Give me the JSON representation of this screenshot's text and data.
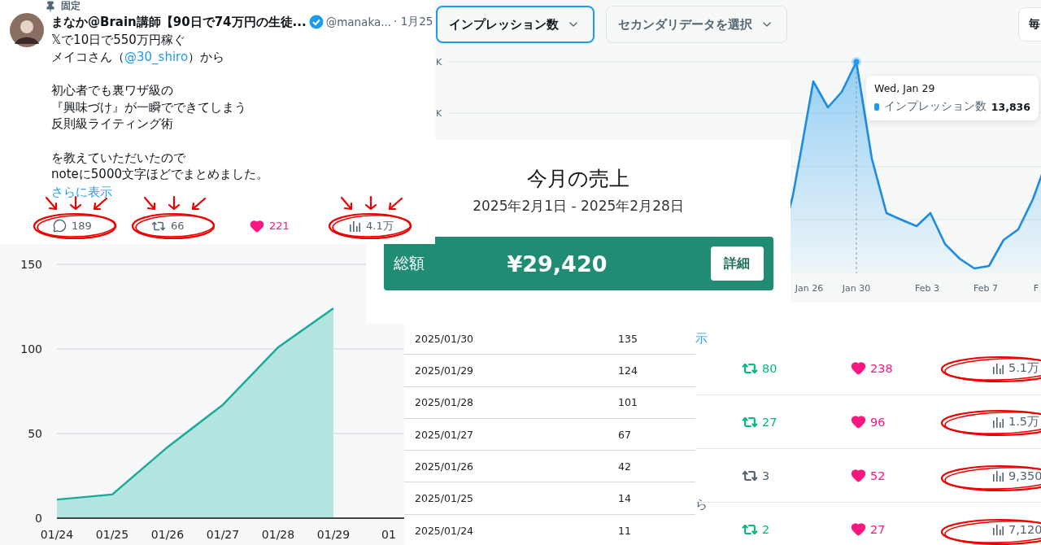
{
  "post": {
    "pinned_label": "固定",
    "author": "まなか@Brain講師【90日で74万円の生徒...",
    "verified": true,
    "handle": "@manaka...",
    "time": "· 1月25",
    "paragraphs": [
      [
        [
          {
            "text": "𝕏で10日で550万円稼ぐ"
          }
        ],
        [
          {
            "text": "メイコさん（"
          },
          {
            "text": "@30_shiro",
            "kind": "link"
          },
          {
            "text": "）から"
          }
        ]
      ],
      [
        [
          {
            "text": "初心者でも裏ワザ級の"
          }
        ],
        [
          {
            "text": "『興味づけ』が一瞬でできてしまう"
          }
        ],
        [
          {
            "text": "反則級ライティング術"
          }
        ]
      ],
      [
        [
          {
            "text": "を教えていただいたので"
          }
        ],
        [
          {
            "text": "noteに5000文字ほどでまとめました。"
          }
        ]
      ]
    ],
    "show_more": "さらに表示",
    "metrics": [
      {
        "kind": "reply",
        "count": "189",
        "circled": true,
        "arrows": true
      },
      {
        "kind": "repost",
        "count": "66",
        "circled": true,
        "arrows": true
      },
      {
        "kind": "like",
        "count": "221",
        "circled": false,
        "arrows": false
      },
      {
        "kind": "views",
        "count": "4.1万",
        "circled": true,
        "arrows": true
      }
    ]
  },
  "analytics": {
    "metric_dropdown": {
      "label": "インプレッション数",
      "focused": true
    },
    "secondary_dropdown": {
      "label": "セカンダリデータを選択",
      "focused": false
    },
    "period_button": "毎",
    "y_labels": [
      "K",
      "K"
    ],
    "x_labels": [
      "Jan 26",
      "Jan 30",
      "Feb 3",
      "Feb 7",
      "F"
    ],
    "tooltip": {
      "date": "Wed, Jan 29",
      "series": "インプレッション数",
      "value": "13,836",
      "color": "#1d9bf0"
    }
  },
  "sales": {
    "title": "今月の売上",
    "period": "2025年2月1日 - 2025年2月28日",
    "total_label": "総額",
    "total": "¥29,420",
    "detail_button": "詳細"
  },
  "sales_chart": {
    "chart_data": {
      "type": "area",
      "categories": [
        "01/24",
        "01/25",
        "01/26",
        "01/27",
        "01/28",
        "01/29",
        "01"
      ],
      "values": [
        11,
        14,
        42,
        67,
        101,
        124,
        null
      ],
      "ylim": [
        0,
        150
      ],
      "yticks": [
        0,
        50,
        100,
        150
      ]
    }
  },
  "sales_table": {
    "rows": [
      {
        "date": "2025/01/30",
        "count": "135"
      },
      {
        "date": "2025/01/29",
        "count": "124"
      },
      {
        "date": "2025/01/28",
        "count": "101"
      },
      {
        "date": "2025/01/27",
        "count": "67"
      },
      {
        "date": "2025/01/26",
        "count": "42"
      },
      {
        "date": "2025/01/25",
        "count": "14"
      },
      {
        "date": "2025/01/24",
        "count": "11"
      }
    ]
  },
  "post_list": {
    "edge_text": [
      "示",
      "ら"
    ],
    "rows": [
      {
        "reposts": "80",
        "reposted": true,
        "likes": "238",
        "liked": true,
        "views": "5.1万",
        "circled": true
      },
      {
        "reposts": "27",
        "reposted": true,
        "likes": "96",
        "liked": true,
        "views": "1.5万",
        "circled": true
      },
      {
        "reposts": "3",
        "reposted": false,
        "likes": "52",
        "liked": true,
        "views": "9,350",
        "circled": true
      },
      {
        "reposts": "2",
        "reposted": true,
        "likes": "27",
        "liked": true,
        "views": "7,120",
        "circled": true
      }
    ]
  }
}
